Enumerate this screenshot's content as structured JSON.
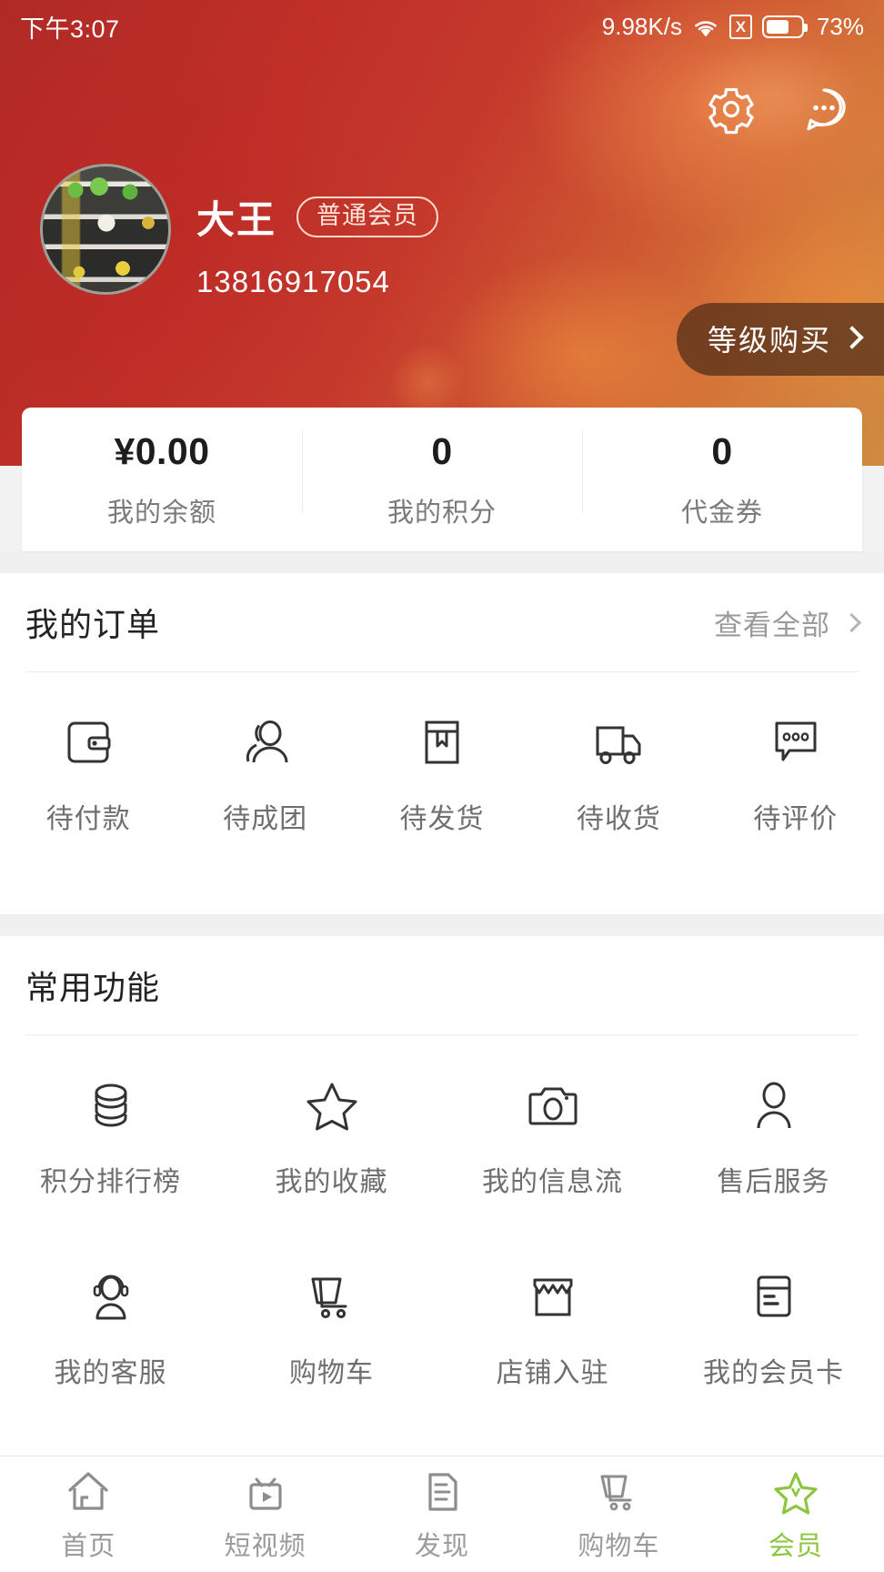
{
  "status_bar": {
    "time": "下午3:07",
    "network_speed": "9.98K/s",
    "sim_glyph": "X",
    "battery_percent": "73%"
  },
  "header": {
    "settings_icon": "gear-icon",
    "message_icon": "chat-bubble-icon",
    "avatar_alt": "user-avatar",
    "user_name": "大王",
    "member_badge": "普通会员",
    "phone": "13816917054",
    "level_buy_label": "等级购买",
    "accent_red": "#c5392c",
    "accent_orange": "#cf8a42"
  },
  "stats": [
    {
      "value": "¥0.00",
      "label": "我的余额"
    },
    {
      "value": "0",
      "label": "我的积分"
    },
    {
      "value": "0",
      "label": "代金券"
    }
  ],
  "orders": {
    "title": "我的订单",
    "more_label": "查看全部",
    "items": [
      {
        "label": "待付款",
        "icon": "wallet-icon"
      },
      {
        "label": "待成团",
        "icon": "group-people-icon"
      },
      {
        "label": "待发货",
        "icon": "package-box-icon"
      },
      {
        "label": "待收货",
        "icon": "delivery-truck-icon"
      },
      {
        "label": "待评价",
        "icon": "comment-bubble-icon"
      }
    ]
  },
  "functions": {
    "title": "常用功能",
    "items": [
      {
        "label": "积分排行榜",
        "icon": "coin-stack-icon"
      },
      {
        "label": "我的收藏",
        "icon": "star-icon"
      },
      {
        "label": "我的信息流",
        "icon": "camera-icon"
      },
      {
        "label": "售后服务",
        "icon": "person-icon"
      },
      {
        "label": "我的客服",
        "icon": "headset-person-icon"
      },
      {
        "label": "购物车",
        "icon": "shopping-cart-icon"
      },
      {
        "label": "店铺入驻",
        "icon": "storefront-icon"
      },
      {
        "label": "我的会员卡",
        "icon": "membership-card-icon"
      },
      {
        "label": "",
        "icon": "coupon-yuan-icon"
      },
      {
        "label": "",
        "icon": "key-link-icon"
      },
      {
        "label": "",
        "icon": "rectangle-tag-icon"
      },
      {
        "label": "",
        "icon": "blank-icon"
      }
    ]
  },
  "bottom_nav": {
    "active_color": "#8cc63f",
    "items": [
      {
        "label": "首页",
        "icon": "home-icon",
        "active": false
      },
      {
        "label": "短视频",
        "icon": "tv-play-icon",
        "active": false
      },
      {
        "label": "发现",
        "icon": "document-icon",
        "active": false
      },
      {
        "label": "购物车",
        "icon": "shopping-cart-icon",
        "active": false
      },
      {
        "label": "会员",
        "icon": "star-icon",
        "active": true
      }
    ]
  }
}
